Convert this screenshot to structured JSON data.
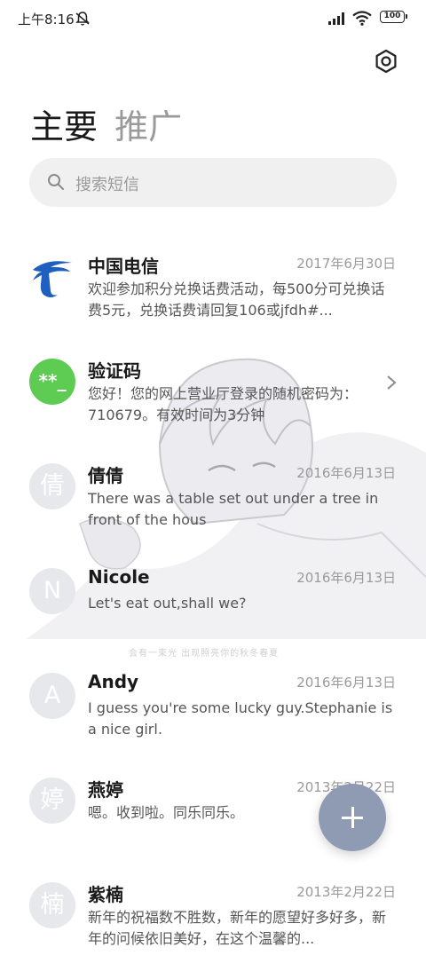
{
  "status_bar": {
    "time": "上午8:16",
    "battery": "100"
  },
  "tabs": [
    {
      "label": "主要"
    },
    {
      "label": "推广"
    }
  ],
  "search": {
    "placeholder": "搜索短信"
  },
  "illustration_caption": "会有一束光 出现照亮你的秋冬春夏",
  "conversations": [
    {
      "name": "中国电信",
      "date": "2017年6月30日",
      "preview": "欢迎参加积分兑换话费活动，每500分可兑换话费5元，兑换话费请回复106或jfdh#...",
      "avatar_text": "",
      "avatar_icon": "china-telecom-logo"
    },
    {
      "name": "验证码",
      "date": "",
      "preview": "您好！您的网上营业厅登录的随机密码为：710679。有效时间为3分钟",
      "avatar_text": "**_",
      "avatar_color": "#5ecb53"
    },
    {
      "name": "倩倩",
      "date": "2016年6月13日",
      "preview": "There was a table set out under a tree in front of the hous",
      "avatar_text": "倩"
    },
    {
      "name": "Nicole",
      "date": "2016年6月13日",
      "preview": "Let's eat out,shall we?",
      "avatar_text": "N"
    },
    {
      "name": "Andy",
      "date": "2016年6月13日",
      "preview": "I guess you're some lucky guy.Stephanie is a nice girl.",
      "avatar_text": "A"
    },
    {
      "name": "燕婷",
      "date": "2013年2月22日",
      "preview": "嗯。收到啦。同乐同乐。",
      "avatar_text": "婷"
    },
    {
      "name": "紫楠",
      "date": "2013年2月22日",
      "preview": "新年的祝福数不胜数，新年的愿望好多好多，新年的问候依旧美好，在这个温馨的...",
      "avatar_text": "楠"
    }
  ],
  "colors": {
    "fab": "#8f9bb2",
    "avatar_default": "#e7e8ec",
    "accent_green": "#5ecb53"
  }
}
